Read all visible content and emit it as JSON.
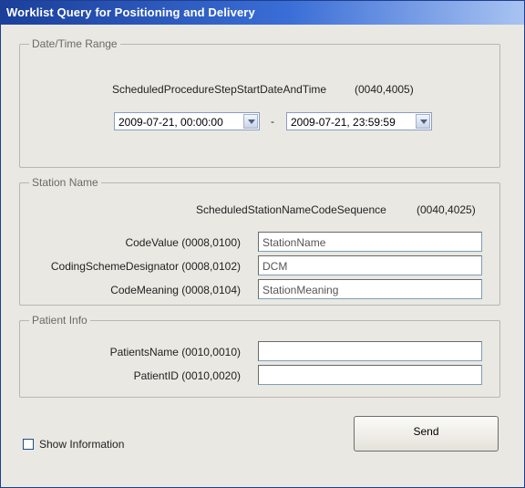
{
  "window": {
    "title": "Worklist Query for Positioning and Delivery"
  },
  "date_time_range": {
    "legend": "Date/Time Range",
    "tag_label": "ScheduledProcedureStepStartDateAndTime",
    "tag_code": "(0040,4005)",
    "start_value": "2009-07-21, 00:00:00",
    "separator": "-",
    "end_value": "2009-07-21, 23:59:59"
  },
  "station_name": {
    "legend": "Station Name",
    "sequence_label": "ScheduledStationNameCodeSequence",
    "sequence_code": "(0040,4025)",
    "fields": [
      {
        "label": "CodeValue (0008,0100)",
        "value": "StationName"
      },
      {
        "label": "CodingSchemeDesignator (0008,0102)",
        "value": "DCM"
      },
      {
        "label": "CodeMeaning (0008,0104)",
        "value": "StationMeaning"
      }
    ]
  },
  "patient_info": {
    "legend": "Patient Info",
    "fields": [
      {
        "label": "PatientsName (0010,0010)",
        "value": ""
      },
      {
        "label": "PatientID (0010,0020)",
        "value": ""
      }
    ]
  },
  "footer": {
    "show_information_label": "Show Information",
    "show_information_checked": false,
    "send_label": "Send"
  }
}
